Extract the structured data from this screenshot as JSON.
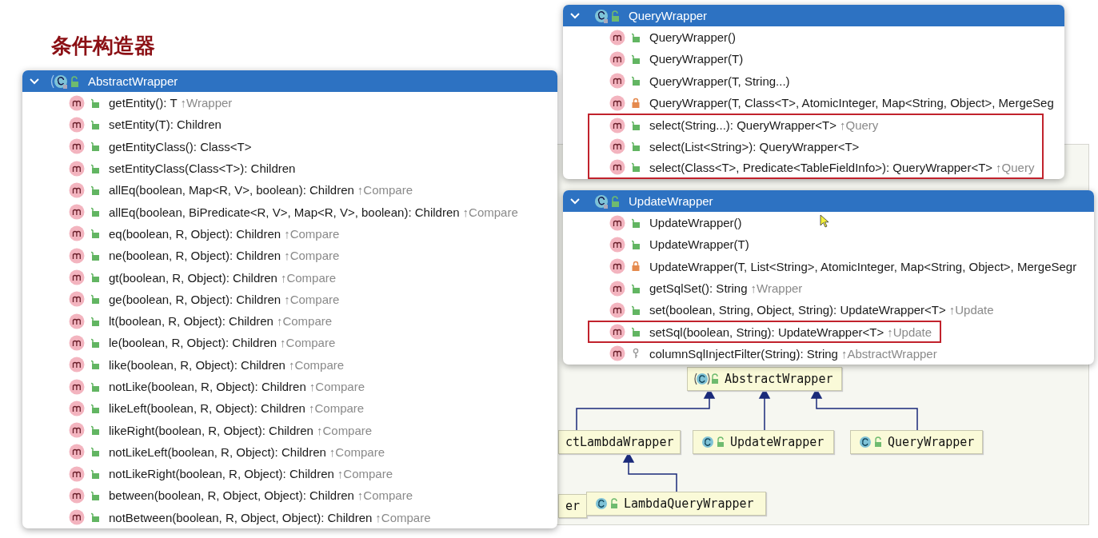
{
  "title": "条件构造器",
  "diagram": {
    "nodes": [
      {
        "label": "AbstractWrapper",
        "kind": "abstract"
      },
      {
        "label": "ctLambdaWrapper",
        "kind": "partial"
      },
      {
        "label": "UpdateWrapper",
        "kind": "class"
      },
      {
        "label": "QueryWrapper",
        "kind": "class"
      },
      {
        "label": "er",
        "kind": "partial"
      },
      {
        "label": "LambdaQueryWrapper",
        "kind": "class"
      }
    ]
  },
  "popups": [
    {
      "class_name": "AbstractWrapper",
      "kind": "abstract",
      "expanded": true,
      "members": [
        {
          "signature": "getEntity(): T",
          "origin": "↑Wrapper",
          "kind": "public",
          "highlighted": false
        },
        {
          "signature": "setEntity(T): Children",
          "kind": "public",
          "highlighted": false
        },
        {
          "signature": "getEntityClass(): Class<T>",
          "kind": "public",
          "highlighted": false
        },
        {
          "signature": "setEntityClass(Class<T>): Children",
          "kind": "public",
          "highlighted": false
        },
        {
          "signature": "allEq(boolean, Map<R, V>, boolean): Children",
          "origin": "↑Compare",
          "kind": "public",
          "highlighted": false
        },
        {
          "signature": "allEq(boolean, BiPredicate<R, V>, Map<R, V>, boolean): Children",
          "origin": "↑Compare",
          "kind": "public",
          "highlighted": false
        },
        {
          "signature": "eq(boolean, R, Object): Children",
          "origin": "↑Compare",
          "kind": "public",
          "highlighted": false
        },
        {
          "signature": "ne(boolean, R, Object): Children",
          "origin": "↑Compare",
          "kind": "public",
          "highlighted": false
        },
        {
          "signature": "gt(boolean, R, Object): Children",
          "origin": "↑Compare",
          "kind": "public",
          "highlighted": false
        },
        {
          "signature": "ge(boolean, R, Object): Children",
          "origin": "↑Compare",
          "kind": "public",
          "highlighted": false
        },
        {
          "signature": "lt(boolean, R, Object): Children",
          "origin": "↑Compare",
          "kind": "public",
          "highlighted": false
        },
        {
          "signature": "le(boolean, R, Object): Children",
          "origin": "↑Compare",
          "kind": "public",
          "highlighted": false
        },
        {
          "signature": "like(boolean, R, Object): Children",
          "origin": "↑Compare",
          "kind": "public",
          "highlighted": false
        },
        {
          "signature": "notLike(boolean, R, Object): Children",
          "origin": "↑Compare",
          "kind": "public",
          "highlighted": false
        },
        {
          "signature": "likeLeft(boolean, R, Object): Children",
          "origin": "↑Compare",
          "kind": "public",
          "highlighted": false
        },
        {
          "signature": "likeRight(boolean, R, Object): Children",
          "origin": "↑Compare",
          "kind": "public",
          "highlighted": false
        },
        {
          "signature": "notLikeLeft(boolean, R, Object): Children",
          "origin": "↑Compare",
          "kind": "public",
          "highlighted": false
        },
        {
          "signature": "notLikeRight(boolean, R, Object): Children",
          "origin": "↑Compare",
          "kind": "public",
          "highlighted": false
        },
        {
          "signature": "between(boolean, R, Object, Object): Children",
          "origin": "↑Compare",
          "kind": "public",
          "highlighted": false
        },
        {
          "signature": "notBetween(boolean, R, Object, Object): Children",
          "origin": "↑Compare",
          "kind": "public",
          "highlighted": false
        }
      ]
    },
    {
      "class_name": "QueryWrapper",
      "kind": "class",
      "expanded": true,
      "members": [
        {
          "signature": "QueryWrapper()",
          "kind": "public",
          "highlighted": false
        },
        {
          "signature": "QueryWrapper(T)",
          "kind": "public",
          "highlighted": false
        },
        {
          "signature": "QueryWrapper(T, String...)",
          "kind": "public",
          "highlighted": false
        },
        {
          "signature": "QueryWrapper(T, Class<T>, AtomicInteger, Map<String, Object>, MergeSeg",
          "kind": "private",
          "highlighted": false
        },
        {
          "signature": "select(String...): QueryWrapper<T>",
          "origin": "↑Query",
          "kind": "public",
          "highlighted": true
        },
        {
          "signature": "select(List<String>): QueryWrapper<T>",
          "kind": "public",
          "highlighted": true
        },
        {
          "signature": "select(Class<T>, Predicate<TableFieldInfo>): QueryWrapper<T>",
          "origin": "↑Query",
          "kind": "public",
          "highlighted": true
        }
      ]
    },
    {
      "class_name": "UpdateWrapper",
      "kind": "class",
      "expanded": true,
      "members": [
        {
          "signature": "UpdateWrapper()",
          "kind": "public",
          "highlighted": false
        },
        {
          "signature": "UpdateWrapper(T)",
          "kind": "public",
          "highlighted": false
        },
        {
          "signature": "UpdateWrapper(T, List<String>, AtomicInteger, Map<String, Object>, MergeSegr",
          "kind": "private",
          "highlighted": false
        },
        {
          "signature": "getSqlSet(): String",
          "origin": "↑Wrapper",
          "kind": "public",
          "highlighted": false
        },
        {
          "signature": "set(boolean, String, Object, String): UpdateWrapper<T>",
          "origin": "↑Update",
          "kind": "public",
          "highlighted": false
        },
        {
          "signature": "setSql(boolean, String): UpdateWrapper<T>",
          "origin": "↑Update",
          "kind": "public",
          "highlighted": true
        },
        {
          "signature": "columnSqlInjectFilter(String): String",
          "origin": "↑AbstractWrapper",
          "kind": "package",
          "highlighted": false
        }
      ]
    }
  ]
}
